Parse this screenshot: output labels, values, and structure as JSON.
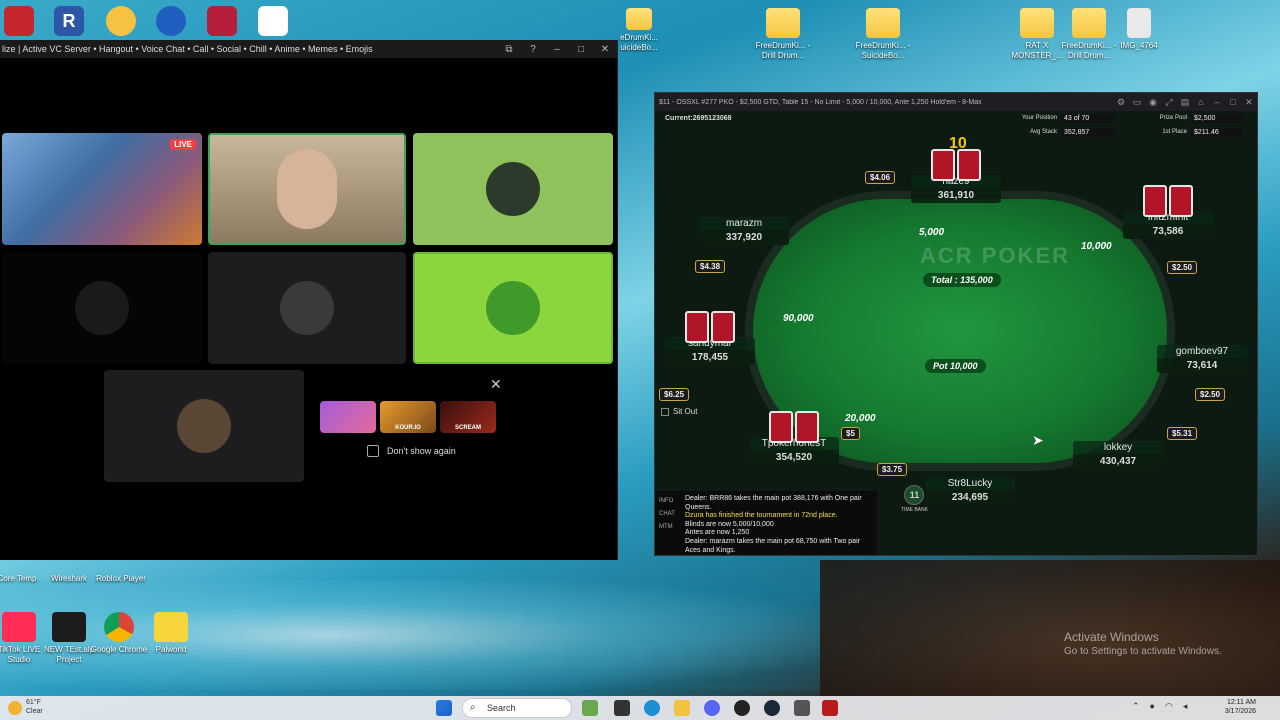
{
  "desktop": {
    "right_icons": [
      {
        "label": "FreeDrumKi... - Drill Drum..."
      },
      {
        "label": "FreeDrumKi... - SuicideBo..."
      },
      {
        "label": "RAT X MONSTER_..."
      },
      {
        "label": "FreeDrumKi... - Drill Drum..."
      },
      {
        "label": "IMG_4764"
      }
    ],
    "top_folder_label": "eDrumKi... uicideBo...",
    "left_icons": [
      {
        "label": "Core Temp"
      },
      {
        "label": "Wireshark"
      },
      {
        "label": "Roblox Player"
      }
    ],
    "bottom_icons": [
      {
        "label": "TikTok LIVE Studio"
      },
      {
        "label": "NEW TEst.alp Project"
      },
      {
        "label": "Google Chrome"
      },
      {
        "label": "Palworld"
      }
    ],
    "activate": {
      "title": "Activate Windows",
      "sub": "Go to Settings to activate Windows."
    }
  },
  "discord": {
    "title": "lize | Active VC Server • Hangout • Voice Chat • Call • Social • Chill • Anime • Memes • Emojis",
    "live_label": "LIVE",
    "popup": {
      "close": "✕",
      "dont_show": "Don't show again",
      "games": [
        "",
        "KOUR.IO",
        "SCREAM"
      ]
    }
  },
  "poker": {
    "title": "$11 - OSSXL #277 PKO - $2,500 GTD, Table 15 - No Limit - 5,000 / 10,000, Ante 1,250 Hold'em - 8-Max",
    "current": "Current:2695123068",
    "info": [
      {
        "label": "Your Position",
        "value": "43 of 70"
      },
      {
        "label": "Avg Stack",
        "value": "352,857"
      }
    ],
    "info_right": [
      {
        "label": "Prize Pool",
        "value": "$2,500"
      },
      {
        "label": "1st Place",
        "value": "$211.46"
      }
    ],
    "dealer_number": "10",
    "logo": "ACR POKER",
    "total": "Total : 135,000",
    "pot": "Pot 10,000",
    "seats": [
      {
        "name": "marazm",
        "stack": "337,920",
        "bounty": "$4.06"
      },
      {
        "name": "haze9",
        "stack": "361,910",
        "bounty": ""
      },
      {
        "name": "Init2mInit",
        "stack": "73,586",
        "bounty": "$2.50"
      },
      {
        "name": "sandymar",
        "stack": "178,455",
        "bounty": "$4.38"
      },
      {
        "name": "gomboev97",
        "stack": "73,614",
        "bounty": "$2.50"
      },
      {
        "name": "TpokerhonesT",
        "stack": "354,520",
        "bounty": "$6.25"
      },
      {
        "name": "lokkey",
        "stack": "430,437",
        "bounty": "$5.31"
      },
      {
        "name": "Str8Lucky",
        "stack": "234,695",
        "bounty": "$3.75"
      }
    ],
    "bets": {
      "haze9": "5,000",
      "init": "10,000",
      "sandy": "90,000",
      "tpoker": "20,000",
      "tpoker_bounty": "$5"
    },
    "sit_out": "Sit Out",
    "time_bank": {
      "number": "11",
      "label": "TIME BANK"
    },
    "chat": {
      "tabs": [
        "INFO",
        "CHAT",
        "MTM"
      ],
      "lines": [
        {
          "text": "Dealer: BRR86 takes the main pot 388,176 with One pair Queens.",
          "highlight": false
        },
        {
          "text": "Dzura has finished the tournament in 72nd place.",
          "highlight": true
        },
        {
          "text": "Blinds are now 5,000/10,000",
          "highlight": false
        },
        {
          "text": "Antes are now 1,250",
          "highlight": false
        },
        {
          "text": "Dealer: marazm takes the main pot 68,750 with Two pair Aces and Kings.",
          "highlight": false
        }
      ]
    }
  },
  "taskbar": {
    "weather_temp": "61°F",
    "weather_desc": "Clear",
    "search": "Search",
    "time": "12:11 AM",
    "date": "3/17/2026"
  }
}
